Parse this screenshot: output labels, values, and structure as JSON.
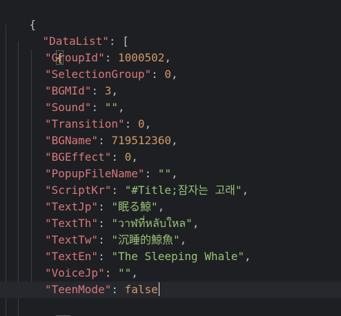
{
  "editor": {
    "root_open": "{",
    "datalist_key": "\"DataList\"",
    "datalist_open": "[",
    "object_open": "{",
    "object_close": "},",
    "fields": [
      {
        "key": "\"GroupId\"",
        "value": "1000502",
        "type": "num",
        "comma": ","
      },
      {
        "key": "\"SelectionGroup\"",
        "value": "0",
        "type": "num",
        "comma": ","
      },
      {
        "key": "\"BGMId\"",
        "value": "3",
        "type": "num",
        "comma": ","
      },
      {
        "key": "\"Sound\"",
        "value": "\"\"",
        "type": "str",
        "comma": ","
      },
      {
        "key": "\"Transition\"",
        "value": "0",
        "type": "num",
        "comma": ","
      },
      {
        "key": "\"BGName\"",
        "value": "719512360",
        "type": "num",
        "comma": ","
      },
      {
        "key": "\"BGEffect\"",
        "value": "0",
        "type": "num",
        "comma": ","
      },
      {
        "key": "\"PopupFileName\"",
        "value": "\"\"",
        "type": "str",
        "comma": ","
      },
      {
        "key": "\"ScriptKr\"",
        "value": "\"#Title;잠자는 고래\"",
        "type": "str",
        "comma": ","
      },
      {
        "key": "\"TextJp\"",
        "value": "\"眠る鯨\"",
        "type": "str",
        "comma": ","
      },
      {
        "key": "\"TextTh\"",
        "value": "\"วาฬที่หลับใหล\"",
        "type": "str",
        "comma": ","
      },
      {
        "key": "\"TextTw\"",
        "value": "\"沉睡的鯨魚\"",
        "type": "str",
        "comma": ","
      },
      {
        "key": "\"TextEn\"",
        "value": "\"The Sleeping Whale\"",
        "type": "str",
        "comma": ","
      },
      {
        "key": "\"VoiceJp\"",
        "value": "\"\"",
        "type": "str",
        "comma": ","
      },
      {
        "key": "\"TeenMode\"",
        "value": "false",
        "type": "kw",
        "comma": ""
      }
    ]
  }
}
